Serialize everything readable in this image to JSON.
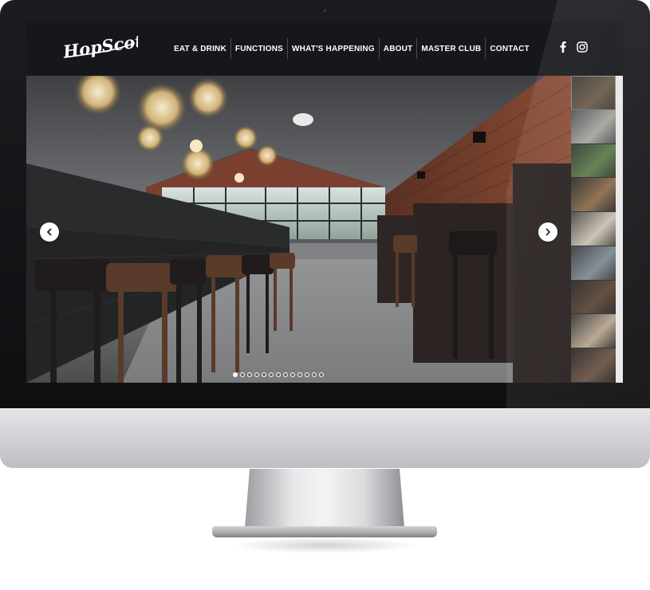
{
  "site": {
    "logo_text": "HopScotch"
  },
  "nav": {
    "items": [
      {
        "label": "EAT & DRINK"
      },
      {
        "label": "FUNCTIONS"
      },
      {
        "label": "WHAT'S HAPPENING"
      },
      {
        "label": "ABOUT"
      },
      {
        "label": "MASTER CLUB"
      },
      {
        "label": "CONTACT"
      }
    ]
  },
  "social": {
    "icons": [
      "facebook-icon",
      "instagram-icon"
    ]
  },
  "slider": {
    "slide_count": 13,
    "active_slide": 1,
    "prev_icon": "chevron-left-icon",
    "next_icon": "chevron-right-icon",
    "thumbnail_count": 9
  },
  "colors": {
    "header_bg": "#15171a",
    "nav_text": "#ffffff",
    "bezel": "#0e0f11",
    "chin": "#cfd0d3"
  }
}
